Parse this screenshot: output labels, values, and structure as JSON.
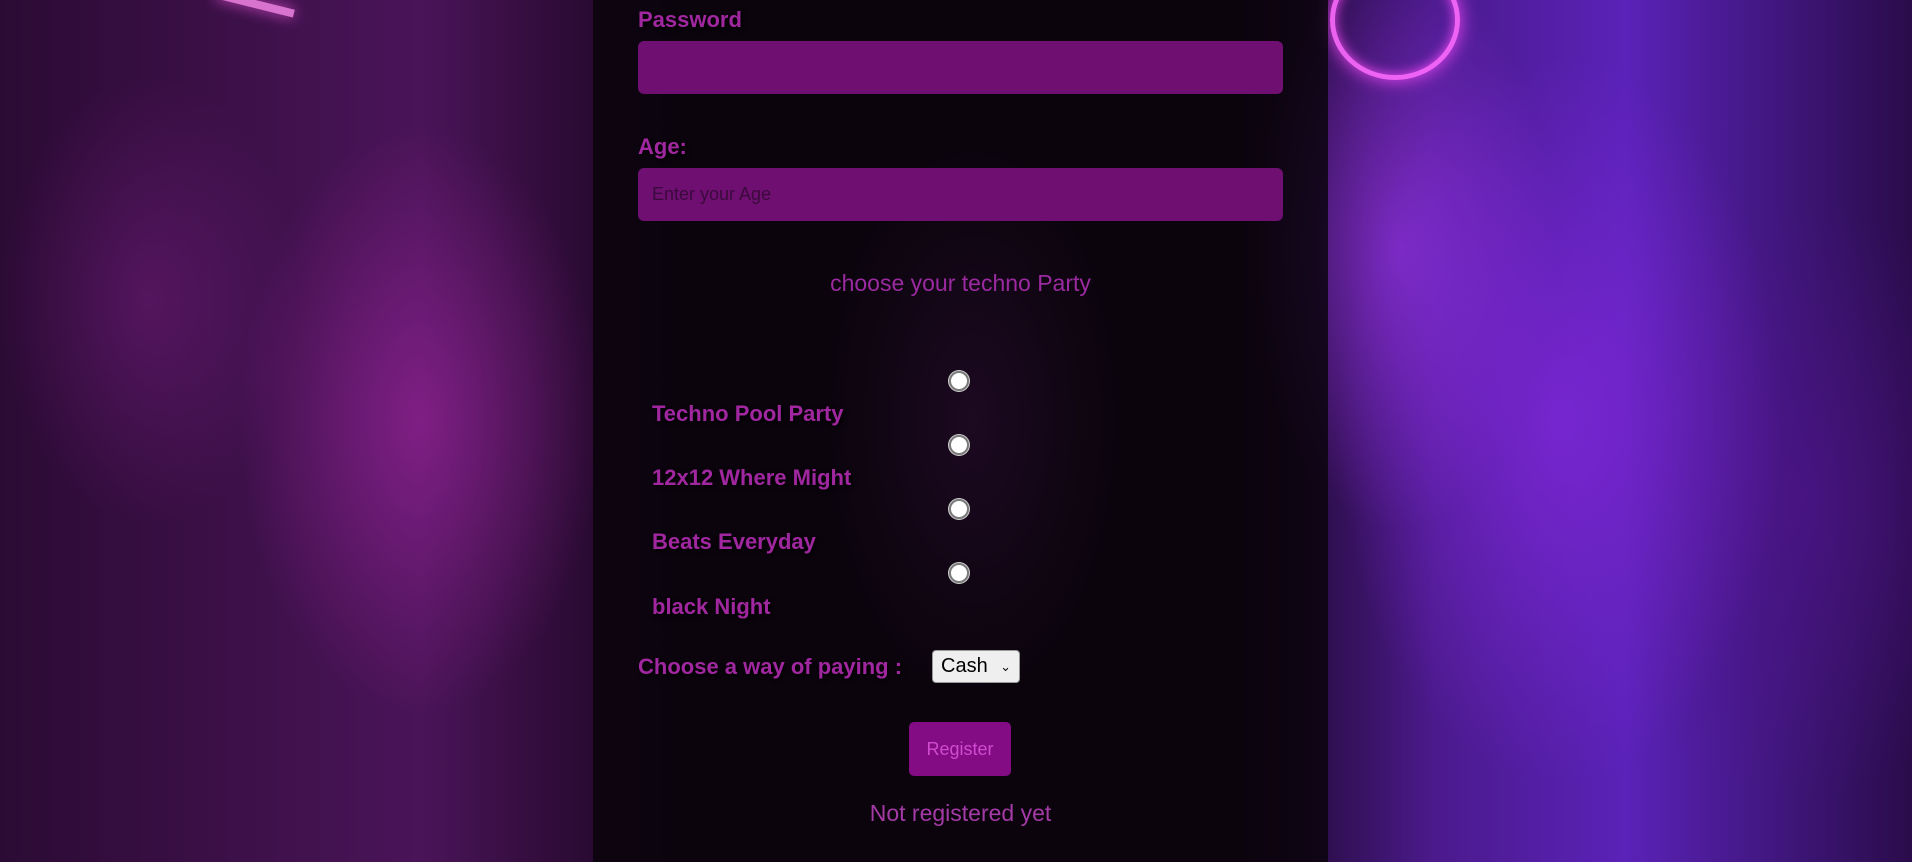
{
  "form": {
    "password_label": "Password",
    "password_value": "",
    "age_label": "Age:",
    "age_placeholder": "Enter your Age",
    "party_title": "choose your techno Party",
    "party_options": [
      {
        "label": "Techno Pool Party",
        "selected": false
      },
      {
        "label": "12x12 Where Might",
        "selected": false
      },
      {
        "label": "Beats Everyday",
        "selected": false
      },
      {
        "label": "black Night",
        "selected": false
      }
    ],
    "payment_label": "Choose a way of paying :",
    "payment_selected": "Cash",
    "register_label": "Register",
    "not_registered_text": "Not registered yet"
  },
  "icons": {
    "select_arrow": "chevron-down-icon"
  },
  "colors": {
    "accent_text": "#a0279f",
    "input_background": "#6f0f72",
    "button_background": "#830c84",
    "panel_background": "#08040a"
  }
}
